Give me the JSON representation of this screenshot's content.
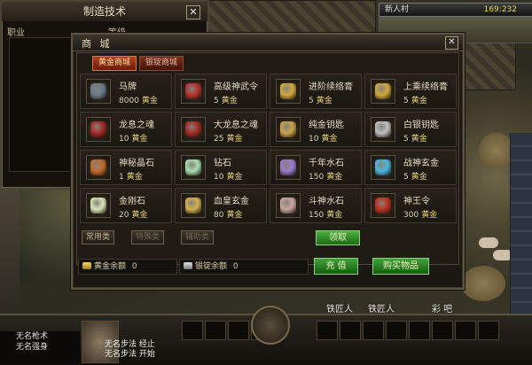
{
  "craft_panel": {
    "title": "制造技术",
    "col_left": "职业",
    "col_right": "等级",
    "close": "✕"
  },
  "location": {
    "map_name": "新人村",
    "coords": "169:232"
  },
  "shop": {
    "title": "商 城",
    "close": "✕",
    "tabs": [
      {
        "label": "黄金商城",
        "active": true
      },
      {
        "label": "银锭商城",
        "active": false
      }
    ],
    "currency": "黄金",
    "items": [
      {
        "name": "马牌",
        "price": "8000",
        "icon": "horse-token-icon",
        "color": "#6a7a8a"
      },
      {
        "name": "高级神武令",
        "price": "5",
        "icon": "red-talisman-icon",
        "color": "#b5322a"
      },
      {
        "name": "进阶续络膏",
        "price": "5",
        "icon": "gold-jar-icon",
        "color": "#d4a83a"
      },
      {
        "name": "上乘续络膏",
        "price": "5",
        "icon": "gold-jar-icon",
        "color": "#d4a83a"
      },
      {
        "name": "龙息之魂",
        "price": "10",
        "icon": "dragon-soul-icon",
        "color": "#a52a25"
      },
      {
        "name": "大龙息之魂",
        "price": "25",
        "icon": "dragon-soul-icon",
        "color": "#a52a25"
      },
      {
        "name": "纯金钥匙",
        "price": "10",
        "icon": "gold-key-icon",
        "color": "#caa24a"
      },
      {
        "name": "白银钥匙",
        "price": "5",
        "icon": "silver-key-icon",
        "color": "#bfbfbf"
      },
      {
        "name": "神秘晶石",
        "price": "1",
        "icon": "mystic-crystal-icon",
        "color": "#c46a2a"
      },
      {
        "name": "钻石",
        "price": "10",
        "icon": "diamond-icon",
        "color": "#a8e0b0"
      },
      {
        "name": "千年水石",
        "price": "150",
        "icon": "water-stone-icon",
        "color": "#9b7ad0"
      },
      {
        "name": "战神玄金",
        "price": "5",
        "icon": "war-gold-icon",
        "color": "#4ab8e0"
      },
      {
        "name": "金刚石",
        "price": "20",
        "icon": "adamant-icon",
        "color": "#d8e6b8"
      },
      {
        "name": "血皇玄金",
        "price": "80",
        "icon": "blood-gold-icon",
        "color": "#d2b04a"
      },
      {
        "name": "斗神水石",
        "price": "150",
        "icon": "fighter-stone-icon",
        "color": "#c9a7a0"
      },
      {
        "name": "神王令",
        "price": "300",
        "icon": "god-king-token-icon",
        "color": "#c03020"
      }
    ],
    "bottom_buttons": [
      {
        "label": "常用类",
        "dim": false
      },
      {
        "label": "特殊类",
        "dim": true
      },
      {
        "label": "辅助类",
        "dim": true
      }
    ],
    "claim_label": "领取",
    "gold_balance_label": "黄金余额",
    "gold_balance": "0",
    "silver_balance_label": "银锭余额",
    "silver_balance": "0",
    "recharge_label": "充 值",
    "buy_label": "购买物品"
  },
  "hud": {
    "chat_lines": [
      "无名枪术",
      "无名强身"
    ],
    "portrait_chat": [
      "无名步法 经止",
      "无名步法 开始"
    ],
    "npc_labels": [
      "铁匠人",
      "铁匠人",
      "彩 吧"
    ]
  }
}
